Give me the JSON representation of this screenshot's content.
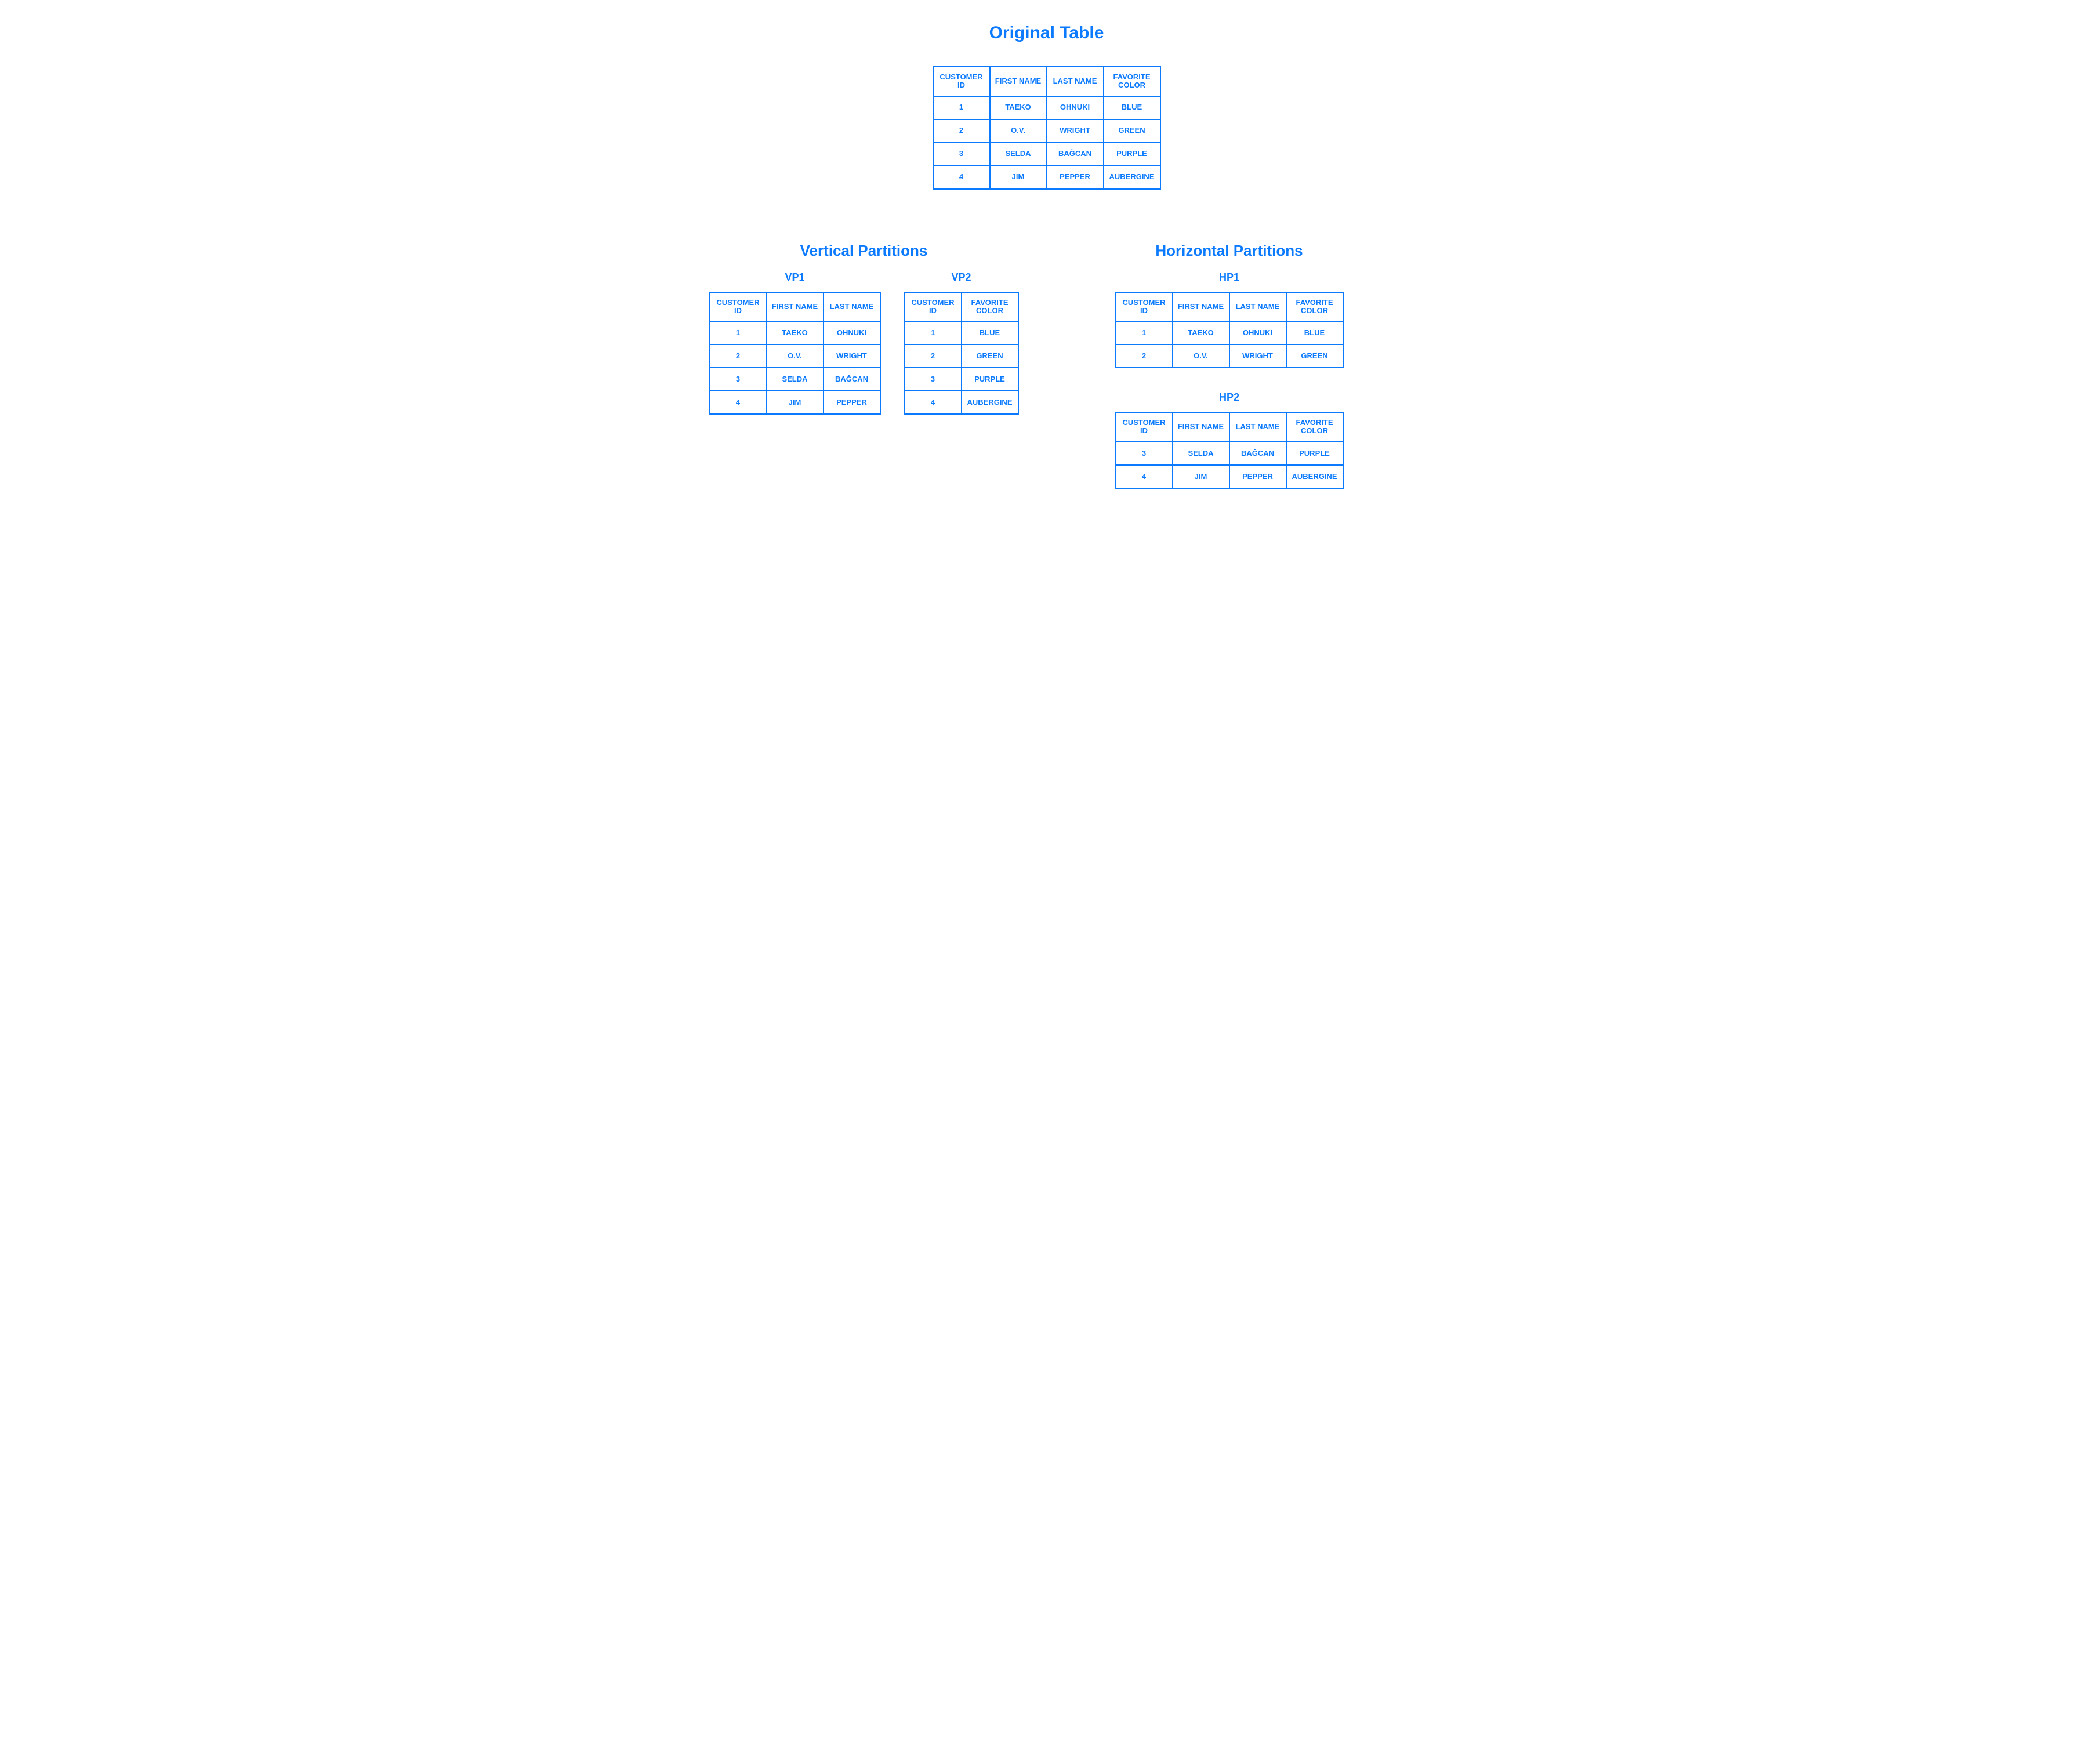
{
  "titles": {
    "original": "Original Table",
    "vertical": "Vertical Partitions",
    "horizontal": "Horizontal Partitions",
    "vp1": "VP1",
    "vp2": "VP2",
    "hp1": "HP1",
    "hp2": "HP2"
  },
  "columns": {
    "customer_id": "CUSTOMER ID",
    "first_name": "FIRST NAME",
    "last_name": "LAST NAME",
    "favorite_color": "FAVORITE COLOR"
  },
  "original": {
    "rows": [
      {
        "id": "1",
        "first": "TAEKO",
        "last": "OHNUKI",
        "color": "BLUE"
      },
      {
        "id": "2",
        "first": "O.V.",
        "last": "WRIGHT",
        "color": "GREEN"
      },
      {
        "id": "3",
        "first": "SELDA",
        "last": "BAĞCAN",
        "color": "PURPLE"
      },
      {
        "id": "4",
        "first": "JIM",
        "last": "PEPPER",
        "color": "AUBERGINE"
      }
    ]
  },
  "vp1": {
    "rows": [
      {
        "id": "1",
        "first": "TAEKO",
        "last": "OHNUKI"
      },
      {
        "id": "2",
        "first": "O.V.",
        "last": "WRIGHT"
      },
      {
        "id": "3",
        "first": "SELDA",
        "last": "BAĞCAN"
      },
      {
        "id": "4",
        "first": "JIM",
        "last": "PEPPER"
      }
    ]
  },
  "vp2": {
    "rows": [
      {
        "id": "1",
        "color": "BLUE"
      },
      {
        "id": "2",
        "color": "GREEN"
      },
      {
        "id": "3",
        "color": "PURPLE"
      },
      {
        "id": "4",
        "color": "AUBERGINE"
      }
    ]
  },
  "hp1": {
    "rows": [
      {
        "id": "1",
        "first": "TAEKO",
        "last": "OHNUKI",
        "color": "BLUE"
      },
      {
        "id": "2",
        "first": "O.V.",
        "last": "WRIGHT",
        "color": "GREEN"
      }
    ]
  },
  "hp2": {
    "rows": [
      {
        "id": "3",
        "first": "SELDA",
        "last": "BAĞCAN",
        "color": "PURPLE"
      },
      {
        "id": "4",
        "first": "JIM",
        "last": "PEPPER",
        "color": "AUBERGINE"
      }
    ]
  }
}
